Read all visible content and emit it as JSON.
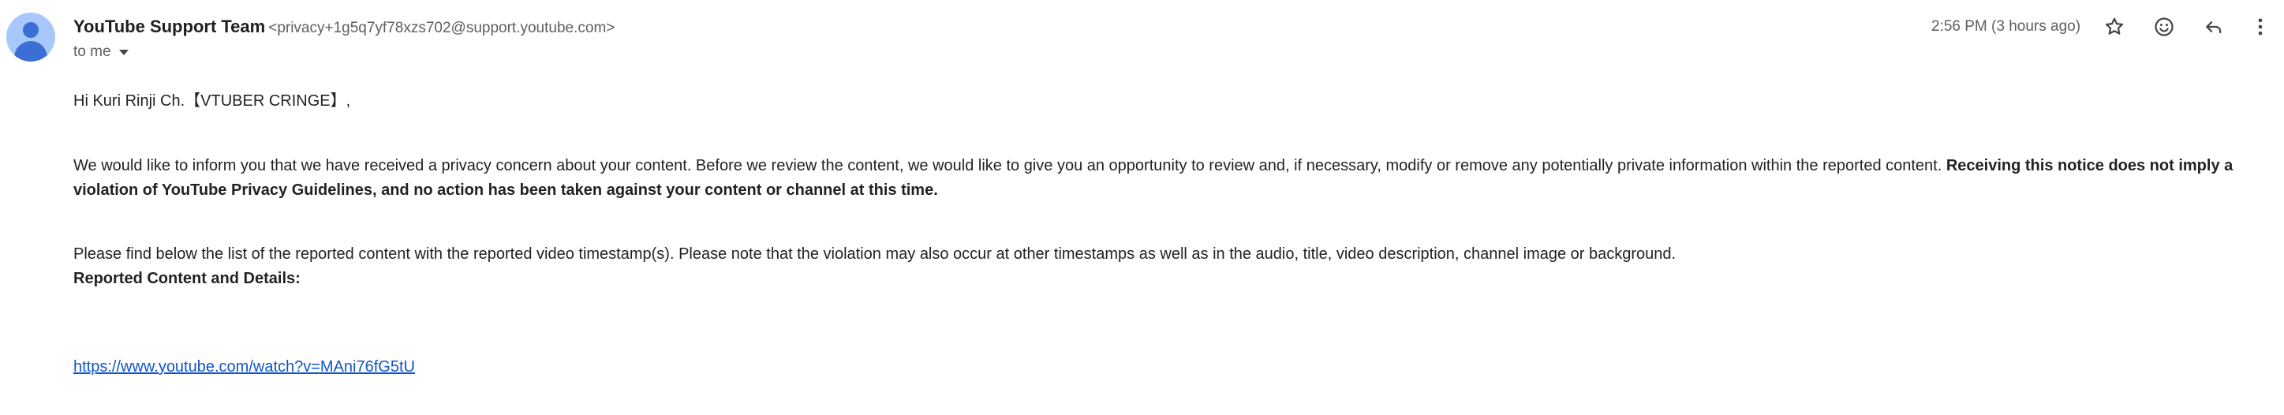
{
  "header": {
    "sender_name": "YouTube Support Team",
    "sender_email": "<privacy+1g5q7yf78xzs702@support.youtube.com>",
    "recipient_label": "to me",
    "timestamp": "2:56 PM (3 hours ago)",
    "icons": {
      "avatar": "person-avatar-icon",
      "star": "star-icon",
      "emoji": "emoji-icon",
      "reply": "reply-icon",
      "more": "more-vertical-icon",
      "details": "chevron-down-icon"
    }
  },
  "message": {
    "greeting": "Hi Kuri Rinji Ch.【VTUBER CRINGE】,",
    "paragraph1_plain": "We would like to inform you that we have received a privacy concern about your content. Before we review the content, we would like to give you an opportunity to review and, if necessary, modify or remove any potentially private information within the reported content. ",
    "paragraph1_bold": "Receiving this notice does not imply a violation of YouTube Privacy Guidelines, and no action has been taken against your content or channel at this time.",
    "paragraph2": "Please find below the list of the reported content with the reported video timestamp(s). Please note that the violation may also occur at other timestamps as well as in the audio, title, video description, channel image or background.",
    "reported_heading": "Reported Content and Details:",
    "video_link": "https://www.youtube.com/watch?v=MAni76fG5tU"
  },
  "colors": {
    "avatar_bg": "#a8c7fa",
    "avatar_fg": "#3b6fd4",
    "link": "#1155cc",
    "secondary_text": "#5e5e5e"
  }
}
